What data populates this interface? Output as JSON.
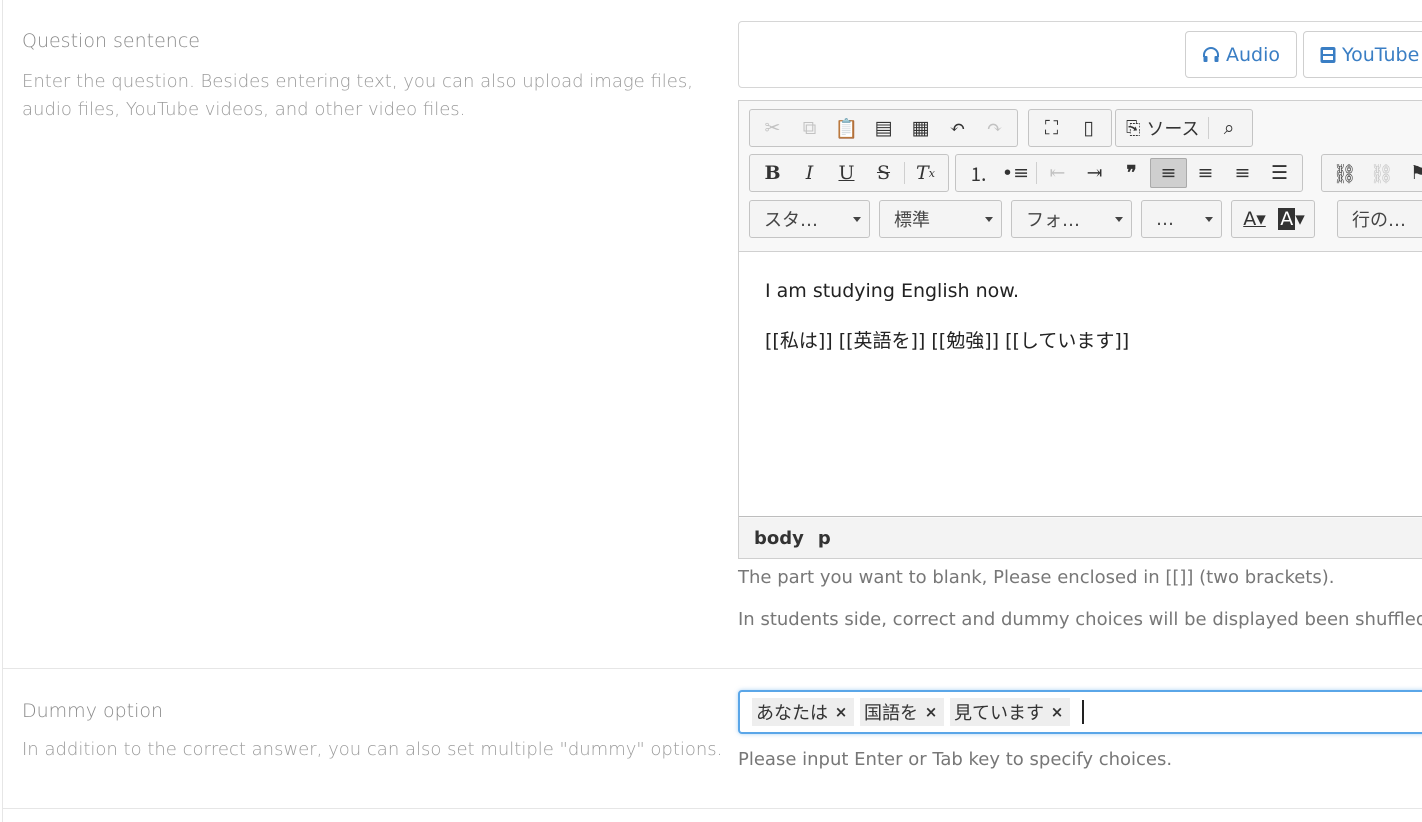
{
  "question": {
    "title": "Question sentence",
    "description": "Enter the question. Besides entering text, you can also upload image files, audio files, YouTube videos, and other video files.",
    "media_buttons": {
      "audio": "Audio",
      "youtube": "YouTube"
    },
    "toolbar": {
      "source_label": "ソース",
      "style_combo": "スタ…",
      "format_combo": "標準",
      "font_combo": "フォ…",
      "size_combo": "…",
      "line_height_combo": "行の…"
    },
    "content_lines": [
      "I am studying English now.",
      "[[私は]] [[英語を]] [[勉強]] [[しています]]"
    ],
    "path": [
      "body",
      "p"
    ],
    "help_1": "The part you want to blank, Please enclosed in [[]] (two brackets).",
    "help_2": "In students side, correct and dummy choices will be displayed been shuffled."
  },
  "dummy": {
    "title": "Dummy option",
    "description": "In addition to the correct answer, you can also set multiple \"dummy\" options.",
    "tags": [
      "あなたは",
      "国語を",
      "見ています"
    ],
    "tag_remove_symbol": "×",
    "help": "Please input Enter or Tab key to specify choices."
  },
  "colors": {
    "link_blue": "#3a7ec4",
    "focus_blue": "#5aa6e8"
  }
}
